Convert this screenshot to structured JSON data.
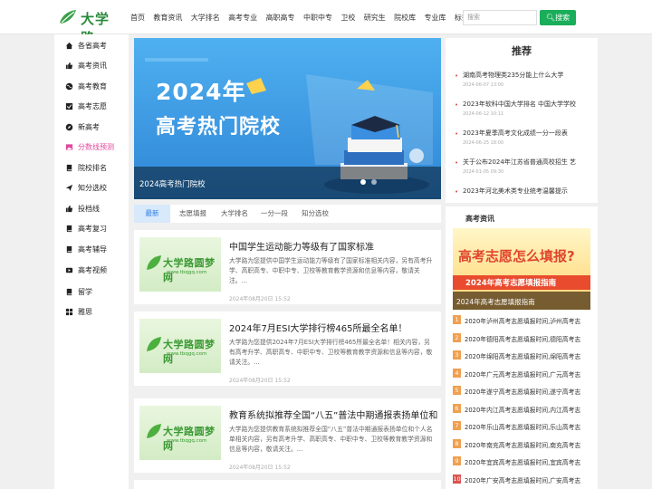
{
  "header": {
    "logo_text": "大学路",
    "nav": [
      "首页",
      "教育资讯",
      "大学排名",
      "高考专业",
      "高职高专",
      "中职中专",
      "卫校",
      "研究生",
      "院校库",
      "专业库",
      "标签"
    ],
    "search_placeholder": "搜索",
    "search_button": "搜索"
  },
  "sidebar": {
    "items": [
      {
        "label": "各省高考",
        "icon": "home-icon"
      },
      {
        "label": "高考资讯",
        "icon": "thumbs-up-icon"
      },
      {
        "label": "高考教育",
        "icon": "globe-icon"
      },
      {
        "label": "高考志愿",
        "icon": "checkbox-icon"
      },
      {
        "label": "新高考",
        "icon": "compass-icon"
      },
      {
        "label": "分数线预测",
        "icon": "image-icon",
        "highlight": true
      },
      {
        "label": "院校排名",
        "icon": "book-icon"
      },
      {
        "label": "知分选校",
        "icon": "send-icon"
      },
      {
        "label": "投档线",
        "icon": "thumbs-up-icon"
      },
      {
        "label": "高考复习",
        "icon": "book-icon"
      },
      {
        "label": "高考辅导",
        "icon": "book-icon"
      },
      {
        "label": "高考视频",
        "icon": "video-icon"
      },
      {
        "label": "留学",
        "icon": "book-icon"
      },
      {
        "label": "雅思",
        "icon": "grid-icon"
      }
    ],
    "highlight_color": "#e0479e"
  },
  "banner": {
    "year": "2024年",
    "headline": "高考热门院校",
    "caption": "2024高考热门院校"
  },
  "tabs": [
    "最新",
    "志愿填报",
    "大学排名",
    "一分一段",
    "知分选校"
  ],
  "articles": [
    {
      "title": "中国学生运动能力等级有了国家标准",
      "desc": "大学路为您提供中国学生运动能力等级有了国家标准相关内容，另有高考升学、高职高专、中职中专、卫校等教育教学资源和信息等内容，敬请关注。...",
      "date": "2024年08月20日 15:52",
      "thumb_brand": "大学路圆梦网",
      "thumb_sub": "www.tbqgq.com"
    },
    {
      "title": "2024年7月ESI大学排行榜465所最全名单！",
      "desc": "大学路为您提供2024年7月ESI大学排行榜465所最全名单！相关内容，另有高考升学、高职高专、中职中专、卫校等教育教学资源和信息等内容，敬请关注。...",
      "date": "2024年08月20日 15:52",
      "thumb_brand": "大学路圆梦网",
      "thumb_sub": "www.tbqgq.com"
    },
    {
      "title": "教育系统拟推荐全国“八五”普法中期通报表扬单位和个人名单",
      "desc": "大学路为您提供教育系统拟推荐全国“八五”普法中期通报表扬单位和个人名单相关内容，另有高考升学、高职高专、中职中专、卫校等教育教学资源和信息等内容，敬请关注。...",
      "date": "2024年08月20日 15:52",
      "thumb_brand": "大学路圆梦网",
      "thumb_sub": "www.tbqgq.com"
    }
  ],
  "recommend": {
    "title": "推荐",
    "items": [
      {
        "title": "湖南高考物理类235分能上什么大学",
        "date": "2024-06-07 13:00"
      },
      {
        "title": "2023年软科中国大学排名 中国大学学校",
        "date": "2024-06-12 10:11"
      },
      {
        "title": "2023年夏季高考文化成绩一分一段表",
        "date": "2024-06-25 18:00"
      },
      {
        "title": "关于公布2024年江苏省普通高校招生 艺",
        "date": "2024-01-05 09:30"
      },
      {
        "title": "2023年河北美术类专业统考温馨提示",
        "date": ""
      }
    ]
  },
  "gaokao_news": {
    "title": "高考资讯",
    "banner_big": "高考志愿怎么填报?",
    "banner_strip": "2024年高考志愿填报指南",
    "banner_caption": "2024年高考志愿填报指南",
    "items": [
      "2020年泸州高考志愿填报时间,泸州高考志",
      "2020年德阳高考志愿填报时间,德阳高考志",
      "2020年绵阳高考志愿填报时间,绵阳高考志",
      "2020年广元高考志愿填报时间,广元高考志",
      "2020年遂宁高考志愿填报时间,遂宁高考志",
      "2020年内江高考志愿填报时间,内江高考志",
      "2020年乐山高考志愿填报时间,乐山高考志",
      "2020年南充高考志愿填报时间,南充高考志",
      "2020年宜宾高考志愿填报时间,宜宾高考志",
      "2020年广安高考志愿填报时间,广安高考志"
    ],
    "numbers": [
      "1",
      "2",
      "3",
      "4",
      "5",
      "6",
      "7",
      "8",
      "9",
      "10"
    ]
  },
  "colors": {
    "brand_green": "#2a8a3c",
    "search_button": "#1aad5a",
    "active_tab": "#2c7be5",
    "bullet_red": "#d9534f"
  }
}
